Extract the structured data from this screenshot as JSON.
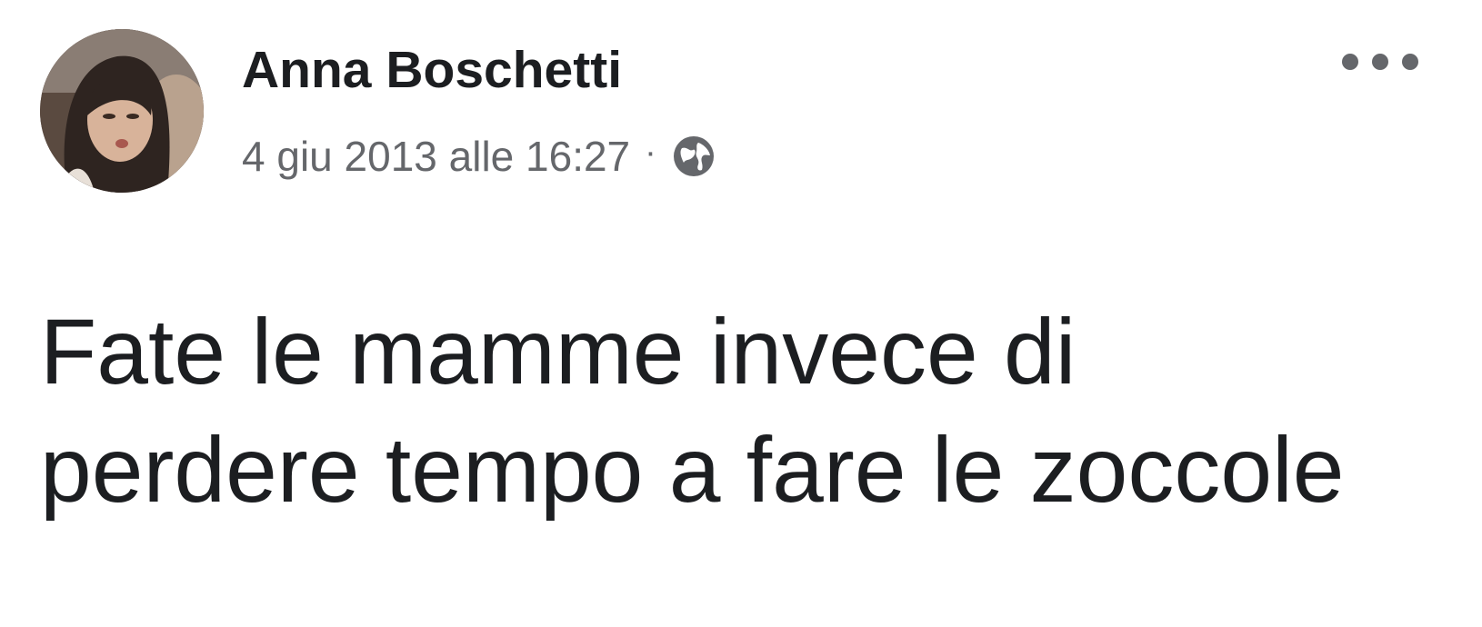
{
  "post": {
    "author": {
      "name": "Anna Boschetti",
      "avatar_icon": "profile-photo"
    },
    "timestamp": "4 giu 2013 alle 16:27",
    "separator": "·",
    "audience_icon": "globe-icon",
    "more_icon": "more-options-icon",
    "text_lines": [
      "Fate le mamme invece di",
      "perdere tempo a fare le zoccole"
    ]
  },
  "colors": {
    "name_text": "#1c1e21",
    "meta_text": "#65676b",
    "body_text": "#1c1e21",
    "background": "#ffffff"
  }
}
